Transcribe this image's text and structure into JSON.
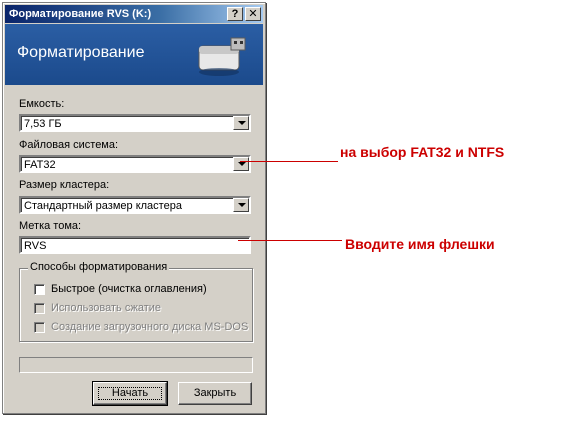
{
  "window": {
    "title": "Форматирование RVS (K:)",
    "help_button": "?",
    "close_button": "✕",
    "banner_title": "Форматирование"
  },
  "form": {
    "capacity": {
      "label": "Емкость:",
      "value": "7,53 ГБ"
    },
    "filesystem": {
      "label": "Файловая система:",
      "value": "FAT32"
    },
    "cluster": {
      "label": "Размер кластера:",
      "value": "Стандартный размер кластера"
    },
    "volume": {
      "label": "Метка тома:",
      "value": "RVS"
    }
  },
  "options": {
    "legend": "Способы форматирования",
    "quick": {
      "label": "Быстрое (очистка оглавления)",
      "checked": false,
      "enabled": true
    },
    "compress": {
      "label": "Использовать сжатие",
      "checked": false,
      "enabled": false
    },
    "msdos": {
      "label": "Создание загрузочного диска MS-DOS",
      "checked": false,
      "enabled": false
    }
  },
  "progress": {
    "value": 0
  },
  "buttons": {
    "start": "Начать",
    "close": "Закрыть"
  },
  "annotations": {
    "filesystem_note": "на выбор FAT32 и NTFS",
    "label_note": "Вводите имя флешки",
    "color": "#cc0000"
  },
  "icons": [
    "usb-drive-icon",
    "help-icon",
    "close-icon",
    "dropdown-arrow-icon",
    "checkbox-icon"
  ]
}
